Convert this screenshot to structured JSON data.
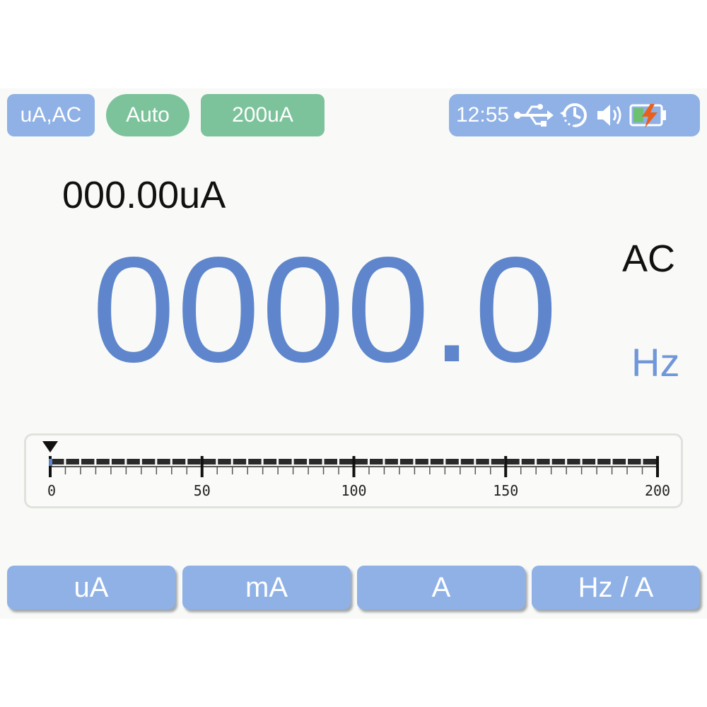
{
  "header": {
    "mode": "uA,AC",
    "auto": "Auto",
    "range": "200uA",
    "status": {
      "time": "12:55",
      "icons": [
        "usb-icon",
        "auto-off-timer-icon",
        "speaker-icon",
        "battery-charging-icon"
      ]
    }
  },
  "display": {
    "secondary_reading": "000.00uA",
    "main_reading": "0000.0",
    "coupling": "AC",
    "unit": "Hz"
  },
  "bargraph": {
    "scale_labels": [
      "0",
      "50",
      "100",
      "150",
      "200"
    ],
    "scale_max": 200,
    "level": 0
  },
  "function_keys": {
    "ua": "uA",
    "ma": "mA",
    "a": "A",
    "hz_a": "Hz / A"
  },
  "colors": {
    "accent_blue": "#8fb1e6",
    "reading_blue": "#5f86cc",
    "badge_green": "#7cc39c",
    "battery_charge": "#e8601c"
  }
}
